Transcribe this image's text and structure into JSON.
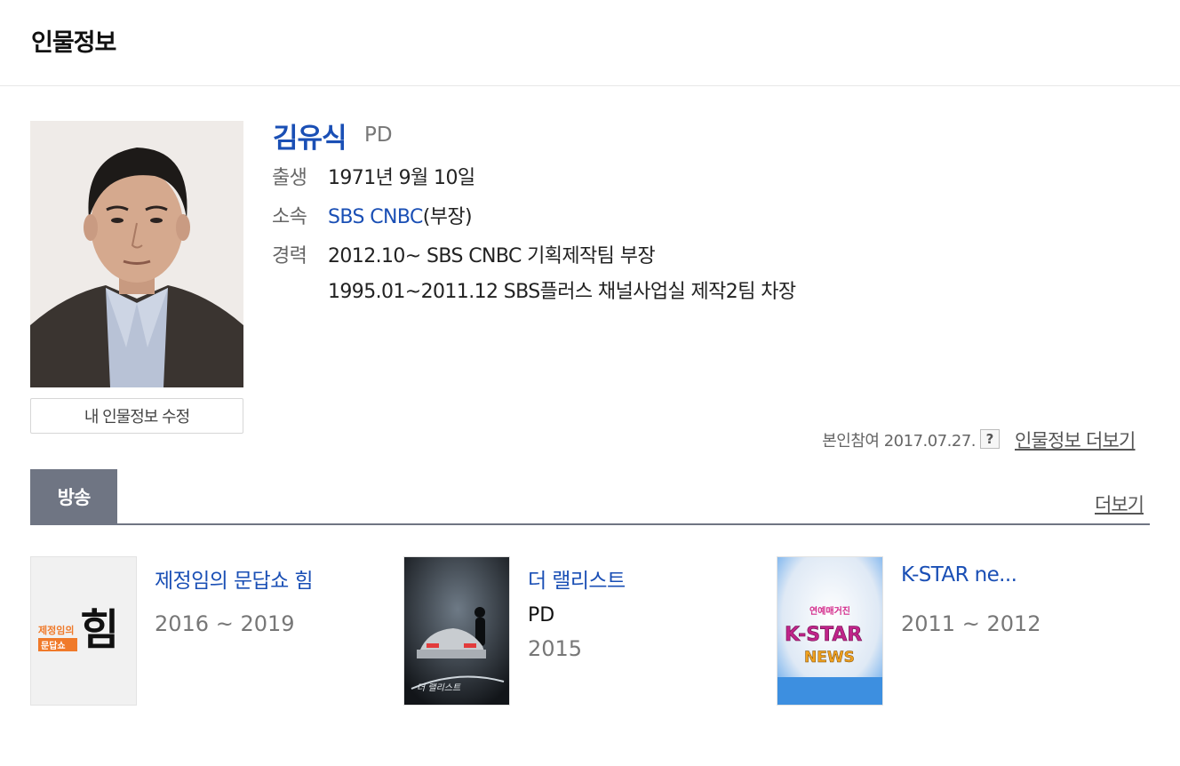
{
  "header": {
    "title": "인물정보"
  },
  "person": {
    "name": "김유식",
    "job": "PD",
    "edit_button": "내 인물정보 수정",
    "birth": {
      "label": "출생",
      "value": "1971년 9월 10일"
    },
    "affiliation": {
      "label": "소속",
      "link": "SBS CNBC",
      "suffix": "(부장)"
    },
    "career": {
      "label": "경력",
      "items": [
        "2012.10~ SBS CNBC 기획제작팀 부장",
        "1995.01~2011.12 SBS플러스 채널사업실 제작2팀 차장"
      ]
    },
    "self_note": "본인참여 2017.07.27.",
    "help_icon": "?",
    "more_info": "인물정보 더보기"
  },
  "tabs": {
    "active": "방송",
    "more": "더보기"
  },
  "shows": [
    {
      "title": "제정임의 문답쇼 힘",
      "role": "",
      "years": "2016 ~ 2019",
      "poster_text": "힘",
      "poster_sub": "제정임의",
      "poster_sub2": "문답쇼"
    },
    {
      "title": "더 랠리스트",
      "role": "PD",
      "years": "2015",
      "poster_text": "더 랠리스트"
    },
    {
      "title": "K-STAR ne...",
      "role": "",
      "years": "2011 ~ 2012",
      "poster_top": "연예매거진",
      "poster_text": "K-STAR",
      "poster_sub": "NEWS"
    }
  ]
}
